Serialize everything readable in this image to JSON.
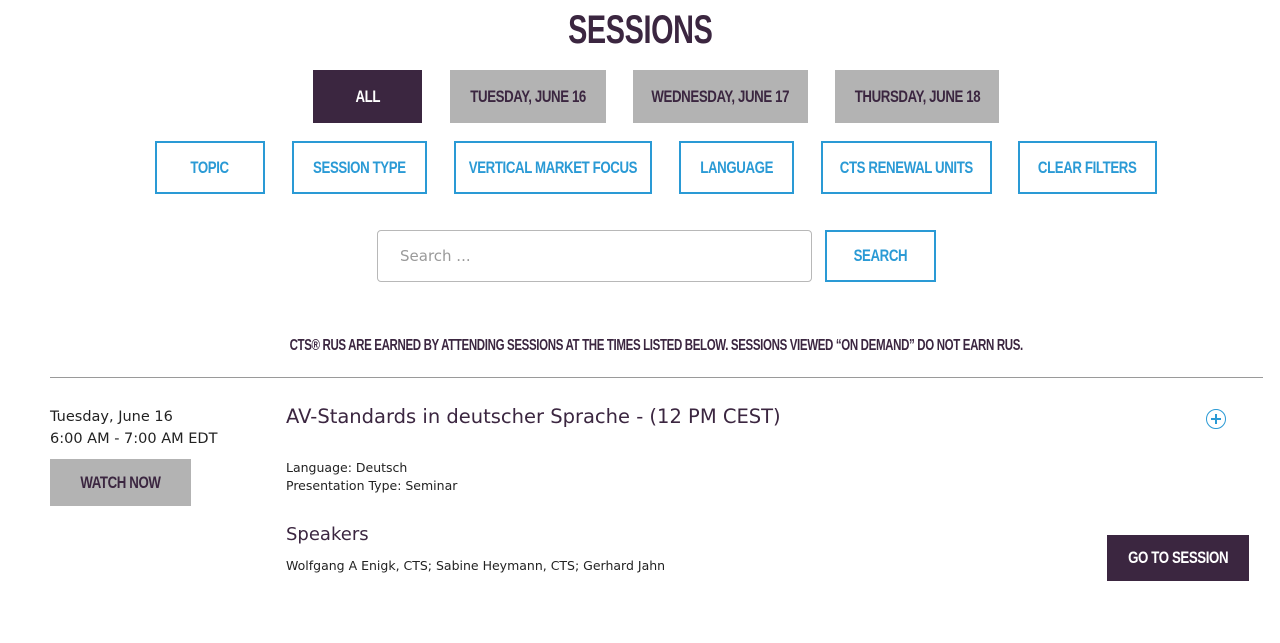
{
  "page": {
    "title": "SESSIONS"
  },
  "day_tabs": [
    {
      "label": "All",
      "active": true
    },
    {
      "label": "Tuesday, June 16",
      "active": false
    },
    {
      "label": "Wednesday, June 17",
      "active": false
    },
    {
      "label": "Thursday, June 18",
      "active": false
    }
  ],
  "filters": [
    {
      "label": "Topic"
    },
    {
      "label": "Session Type"
    },
    {
      "label": "Vertical Market Focus"
    },
    {
      "label": "Language"
    },
    {
      "label": "CTS Renewal Units"
    },
    {
      "label": "Clear Filters"
    }
  ],
  "search": {
    "placeholder": "Search ...",
    "value": "",
    "button_label": "Search"
  },
  "notice": "CTS® RUs are earned by attending sessions at the times listed below. Sessions viewed “on demand” do not earn RUs.",
  "session": {
    "date": "Tuesday, June 16",
    "time": "6:00 AM - 7:00 AM EDT",
    "watch_label": "Watch Now",
    "title": "AV-Standards in deutscher Sprache - (12 PM CEST)",
    "expand_icon": "plus-circle-icon",
    "language": "Language: Deutsch",
    "presentation_type": "Presentation Type: Seminar",
    "speakers_heading": "Speakers",
    "speakers": "Wolfgang A Enigk, CTS; Sabine Heymann, CTS; Gerhard Jahn",
    "go_label": "Go to Session"
  },
  "colors": {
    "brand": "#3b2640",
    "accent": "#2a9ad5",
    "muted": "#b3b3b3"
  }
}
